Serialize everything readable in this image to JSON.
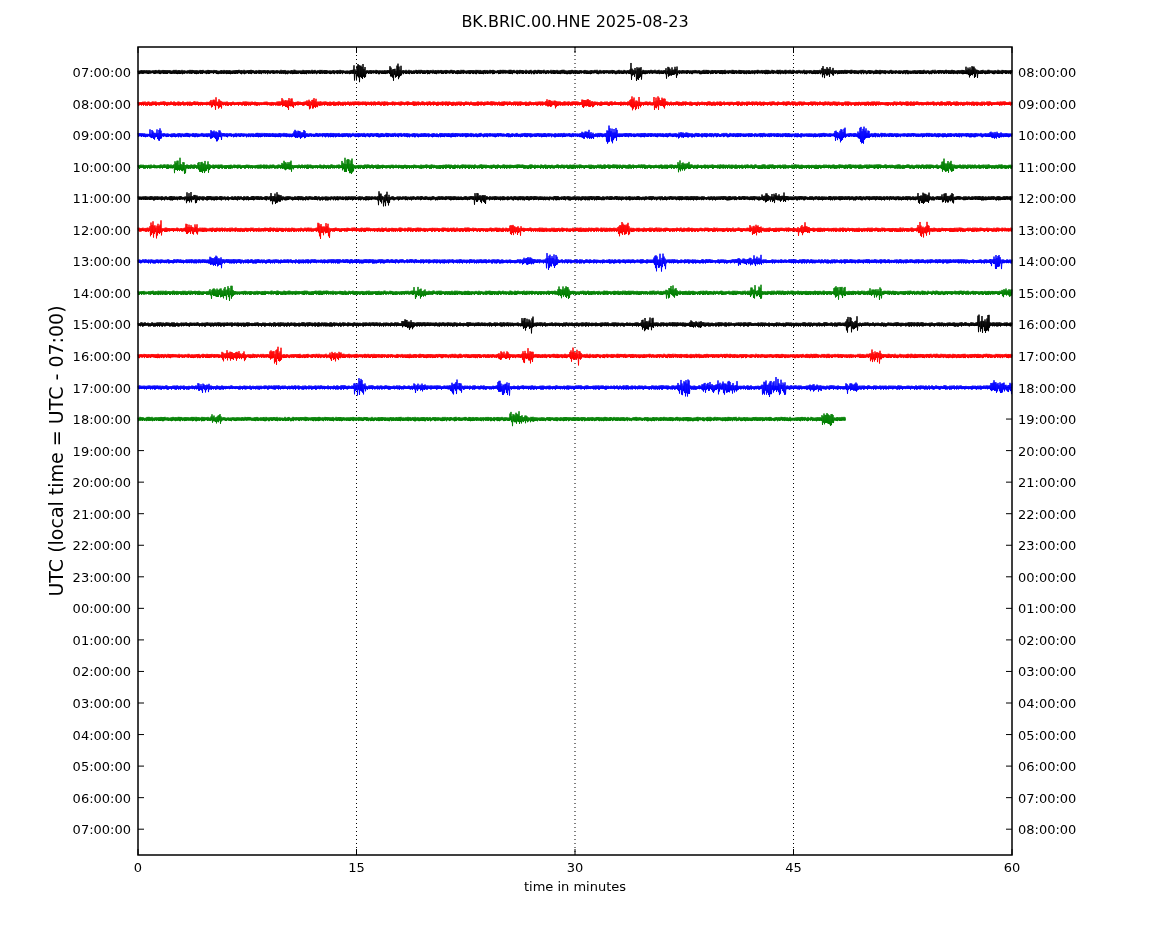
{
  "plot": {
    "title": "BK.BRIC.00.HNE 2025-08-23",
    "ylabel": "UTC (local time = UTC - 07:00)",
    "xlabel": "time in minutes",
    "xticks": [
      "0",
      "15",
      "30",
      "45",
      "60"
    ],
    "rows": [
      {
        "left": "07:00:00",
        "right": "08:00:00",
        "trace": {
          "color": "#000000",
          "level": 1
        }
      },
      {
        "left": "08:00:00",
        "right": "09:00:00",
        "trace": {
          "color": "#ff0000",
          "level": 1
        }
      },
      {
        "left": "09:00:00",
        "right": "10:00:00",
        "trace": {
          "color": "#0000ff",
          "level": 1
        }
      },
      {
        "left": "10:00:00",
        "right": "11:00:00",
        "trace": {
          "color": "#008000",
          "level": 1
        }
      },
      {
        "left": "11:00:00",
        "right": "12:00:00",
        "trace": {
          "color": "#000000",
          "level": 1
        }
      },
      {
        "left": "12:00:00",
        "right": "13:00:00",
        "trace": {
          "color": "#ff0000",
          "level": 1
        }
      },
      {
        "left": "13:00:00",
        "right": "14:00:00",
        "trace": {
          "color": "#0000ff",
          "level": 1
        }
      },
      {
        "left": "14:00:00",
        "right": "15:00:00",
        "trace": {
          "color": "#008000",
          "level": 1
        }
      },
      {
        "left": "15:00:00",
        "right": "16:00:00",
        "trace": {
          "color": "#000000",
          "level": 1
        }
      },
      {
        "left": "16:00:00",
        "right": "17:00:00",
        "trace": {
          "color": "#ff0000",
          "level": 1
        }
      },
      {
        "left": "17:00:00",
        "right": "18:00:00",
        "trace": {
          "color": "#0000ff",
          "level": 1
        }
      },
      {
        "left": "18:00:00",
        "right": "19:00:00",
        "trace": {
          "color": "#008000",
          "level": 0.81
        }
      },
      {
        "left": "19:00:00",
        "right": "20:00:00"
      },
      {
        "left": "20:00:00",
        "right": "21:00:00"
      },
      {
        "left": "21:00:00",
        "right": "22:00:00"
      },
      {
        "left": "22:00:00",
        "right": "23:00:00"
      },
      {
        "left": "23:00:00",
        "right": "00:00:00"
      },
      {
        "left": "00:00:00",
        "right": "01:00:00"
      },
      {
        "left": "01:00:00",
        "right": "02:00:00"
      },
      {
        "left": "02:00:00",
        "right": "03:00:00"
      },
      {
        "left": "03:00:00",
        "right": "04:00:00"
      },
      {
        "left": "04:00:00",
        "right": "05:00:00"
      },
      {
        "left": "05:00:00",
        "right": "06:00:00"
      },
      {
        "left": "06:00:00",
        "right": "07:00:00"
      },
      {
        "left": "07:00:00",
        "right": "08:00:00"
      }
    ]
  }
}
